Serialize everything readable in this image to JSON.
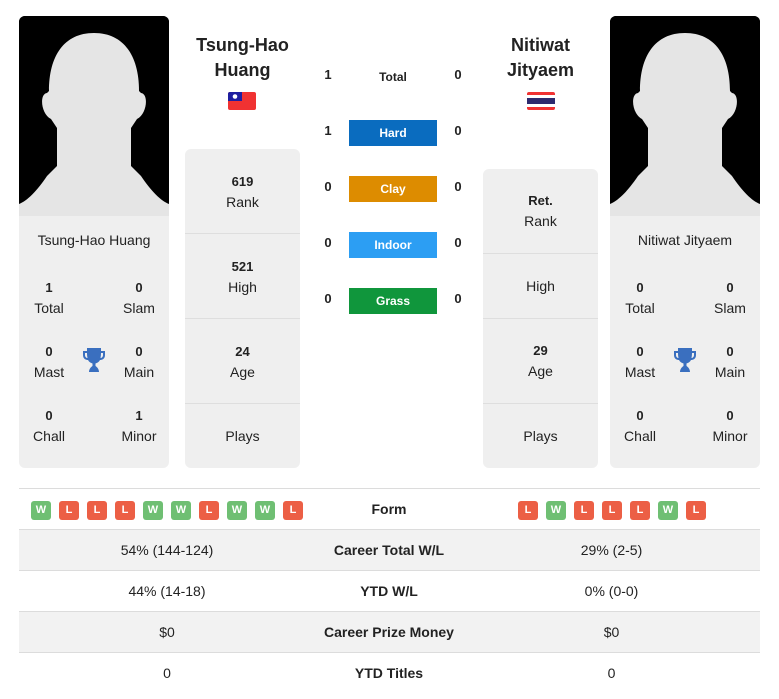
{
  "colors": {
    "hard": "#0a6cbf",
    "clay": "#dd8c00",
    "indoor": "#2c9ef3",
    "grass": "#10963c",
    "win": "#6fbf73",
    "loss": "#ec5f45",
    "trophy": "#3a6fbf"
  },
  "player1": {
    "name_line1": "Tsung-Hao",
    "name_line2": "Huang",
    "full_name": "Tsung-Hao Huang",
    "flag": "taiwan-flag",
    "titles": {
      "total": "1",
      "total_label": "Total",
      "slam": "0",
      "slam_label": "Slam",
      "mast": "0",
      "mast_label": "Mast",
      "main": "0",
      "main_label": "Main",
      "chall": "0",
      "chall_label": "Chall",
      "minor": "1",
      "minor_label": "Minor"
    },
    "stats": {
      "rank": "619",
      "rank_label": "Rank",
      "high": "521",
      "high_label": "High",
      "age": "24",
      "age_label": "Age",
      "plays": "",
      "plays_label": "Plays"
    },
    "form": [
      "W",
      "L",
      "L",
      "L",
      "W",
      "W",
      "L",
      "W",
      "W",
      "L"
    ]
  },
  "player2": {
    "name_line1": "Nitiwat",
    "name_line2": "Jityaem",
    "full_name": "Nitiwat Jityaem",
    "flag": "thailand-flag",
    "titles": {
      "total": "0",
      "total_label": "Total",
      "slam": "0",
      "slam_label": "Slam",
      "mast": "0",
      "mast_label": "Mast",
      "main": "0",
      "main_label": "Main",
      "chall": "0",
      "chall_label": "Chall",
      "minor": "0",
      "minor_label": "Minor"
    },
    "stats": {
      "rank": "Ret.",
      "rank_label": "Rank",
      "high": "",
      "high_label": "High",
      "age": "29",
      "age_label": "Age",
      "plays": "",
      "plays_label": "Plays"
    },
    "form": [
      "L",
      "W",
      "L",
      "L",
      "L",
      "W",
      "L"
    ]
  },
  "h2h": [
    {
      "label": "Total",
      "p1": "1",
      "p2": "0"
    },
    {
      "label": "Hard",
      "p1": "1",
      "p2": "0"
    },
    {
      "label": "Clay",
      "p1": "0",
      "p2": "0"
    },
    {
      "label": "Indoor",
      "p1": "0",
      "p2": "0"
    },
    {
      "label": "Grass",
      "p1": "0",
      "p2": "0"
    }
  ],
  "comparison": [
    {
      "label": "Form",
      "p1": "",
      "p2": ""
    },
    {
      "label": "Career Total W/L",
      "p1": "54% (144-124)",
      "p2": "29% (2-5)"
    },
    {
      "label": "YTD W/L",
      "p1": "44% (14-18)",
      "p2": "0% (0-0)"
    },
    {
      "label": "Career Prize Money",
      "p1": "$0",
      "p2": "$0"
    },
    {
      "label": "YTD Titles",
      "p1": "0",
      "p2": "0"
    }
  ]
}
